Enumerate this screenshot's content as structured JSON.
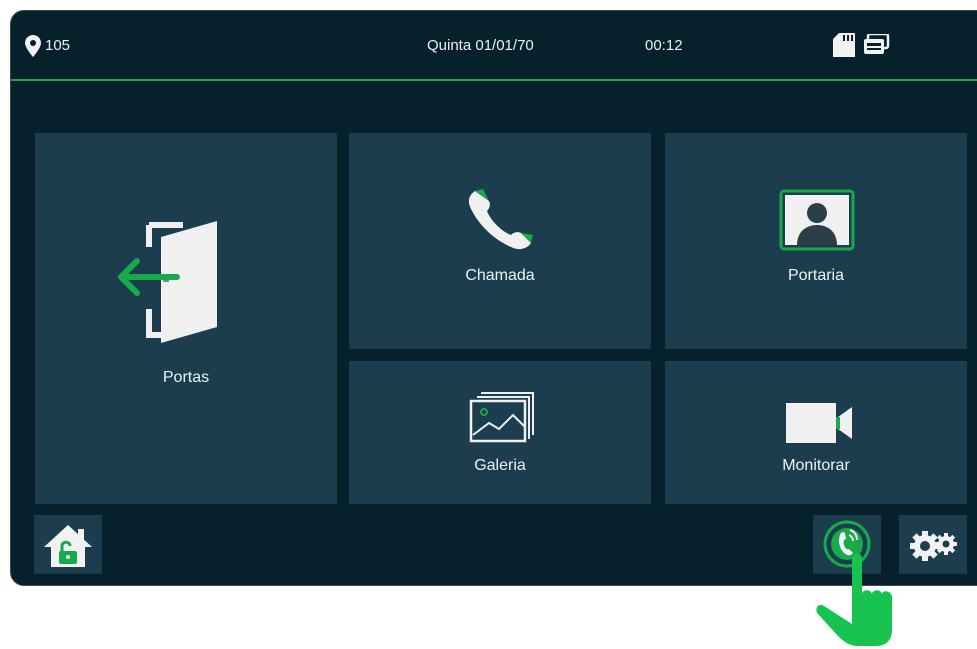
{
  "status": {
    "location": "105",
    "date": "Quinta 01/01/70",
    "time": "00:12",
    "icons": [
      "location-pin-icon",
      "sd-card-icon",
      "memory-icon"
    ]
  },
  "tiles": {
    "portas": {
      "label": "Portas",
      "icon": "door-exit-icon"
    },
    "chamada": {
      "label": "Chamada",
      "icon": "phone-icon"
    },
    "portaria": {
      "label": "Portaria",
      "icon": "doorman-portrait-icon"
    },
    "galeria": {
      "label": "Galeria",
      "icon": "gallery-icon"
    },
    "monitorar": {
      "label": "Monitorar",
      "icon": "video-camera-icon"
    }
  },
  "bottom": {
    "icons": [
      "home-unlock-icon",
      "intercom-touch-icon",
      "settings-gears-icon"
    ]
  },
  "colors": {
    "background": "#06202c",
    "tile": "#1b3d4d",
    "accent": "#17a94a",
    "text": "#eef2f3"
  }
}
